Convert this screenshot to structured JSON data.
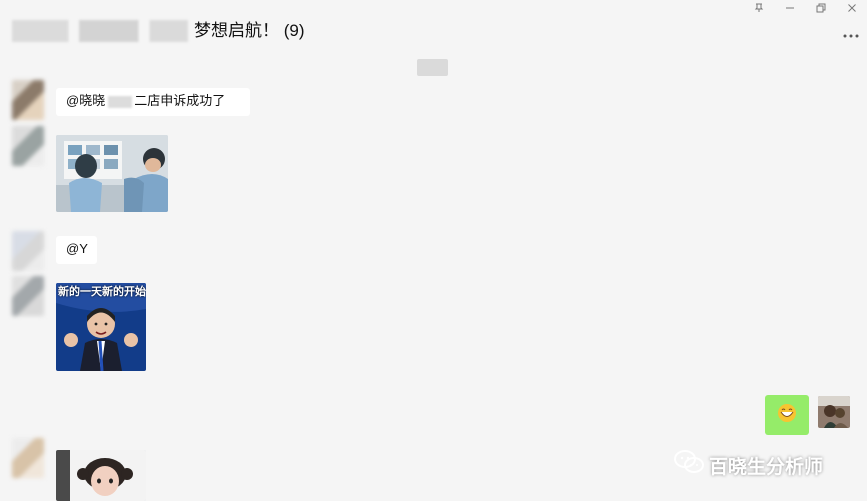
{
  "header": {
    "chat_title": "梦想启航！ (9)",
    "window_controls": {
      "pin": "pin-icon",
      "minimize": "minimize-icon",
      "restore": "restore-icon",
      "close": "close-icon"
    },
    "more": "more-icon"
  },
  "messages": {
    "mention_text": "@晓晓",
    "appeal_text": "二店申诉成功了",
    "mention_y": "@Y",
    "sticker_caption": "新的一天新的开始"
  },
  "watermark": {
    "text": "百晓生分析师",
    "icon": "wechat-icon"
  },
  "colors": {
    "background": "#f5f5f5",
    "received_bubble": "#ffffff",
    "sent_bubble": "#95ec69"
  }
}
